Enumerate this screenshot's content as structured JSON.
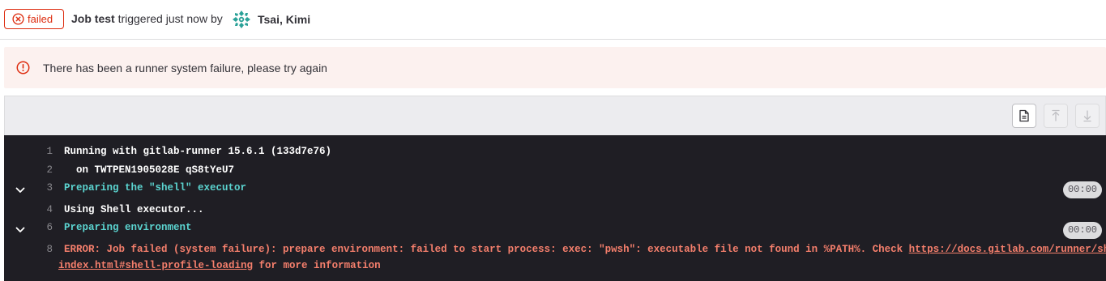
{
  "header": {
    "status": "failed",
    "job_label": "Job test",
    "triggered_text": " triggered just now by ",
    "user": "Tsai, Kimi"
  },
  "alert": {
    "message": "There has been a runner system failure, please try again"
  },
  "toolbar": {
    "buttons": [
      {
        "name": "show-raw-icon",
        "enabled": true
      },
      {
        "name": "scroll-top-icon",
        "enabled": false
      },
      {
        "name": "scroll-bottom-icon",
        "enabled": false
      }
    ]
  },
  "log": {
    "lines": [
      {
        "num": "1",
        "text": "Running with gitlab-runner 15.6.1 (133d7e76)"
      },
      {
        "num": "2",
        "text": "  on TWTPEN1905028E qS8tYeU7"
      },
      {
        "num": "3",
        "text": "Preparing the \"shell\" executor",
        "duration": "00:00"
      },
      {
        "num": "4",
        "text": "Using Shell executor..."
      },
      {
        "num": "6",
        "text": "Preparing environment",
        "duration": "00:00"
      },
      {
        "num": "8",
        "text": "ERROR: Job failed (system failure): prepare environment: failed to start process: exec: \"pwsh\": executable file not found in %PATH%. Check ",
        "link_part1": "https://docs.gitlab.com/runner/shells/",
        "link_part2": "index.html#shell-profile-loading",
        "suffix": " for more information"
      }
    ]
  },
  "colors": {
    "danger": "#dd2b0e",
    "alert_bg": "#fcf1ef",
    "log_bg": "#1f1e24",
    "section_text": "#5bd4d0",
    "error_text": "#f57f6c"
  }
}
